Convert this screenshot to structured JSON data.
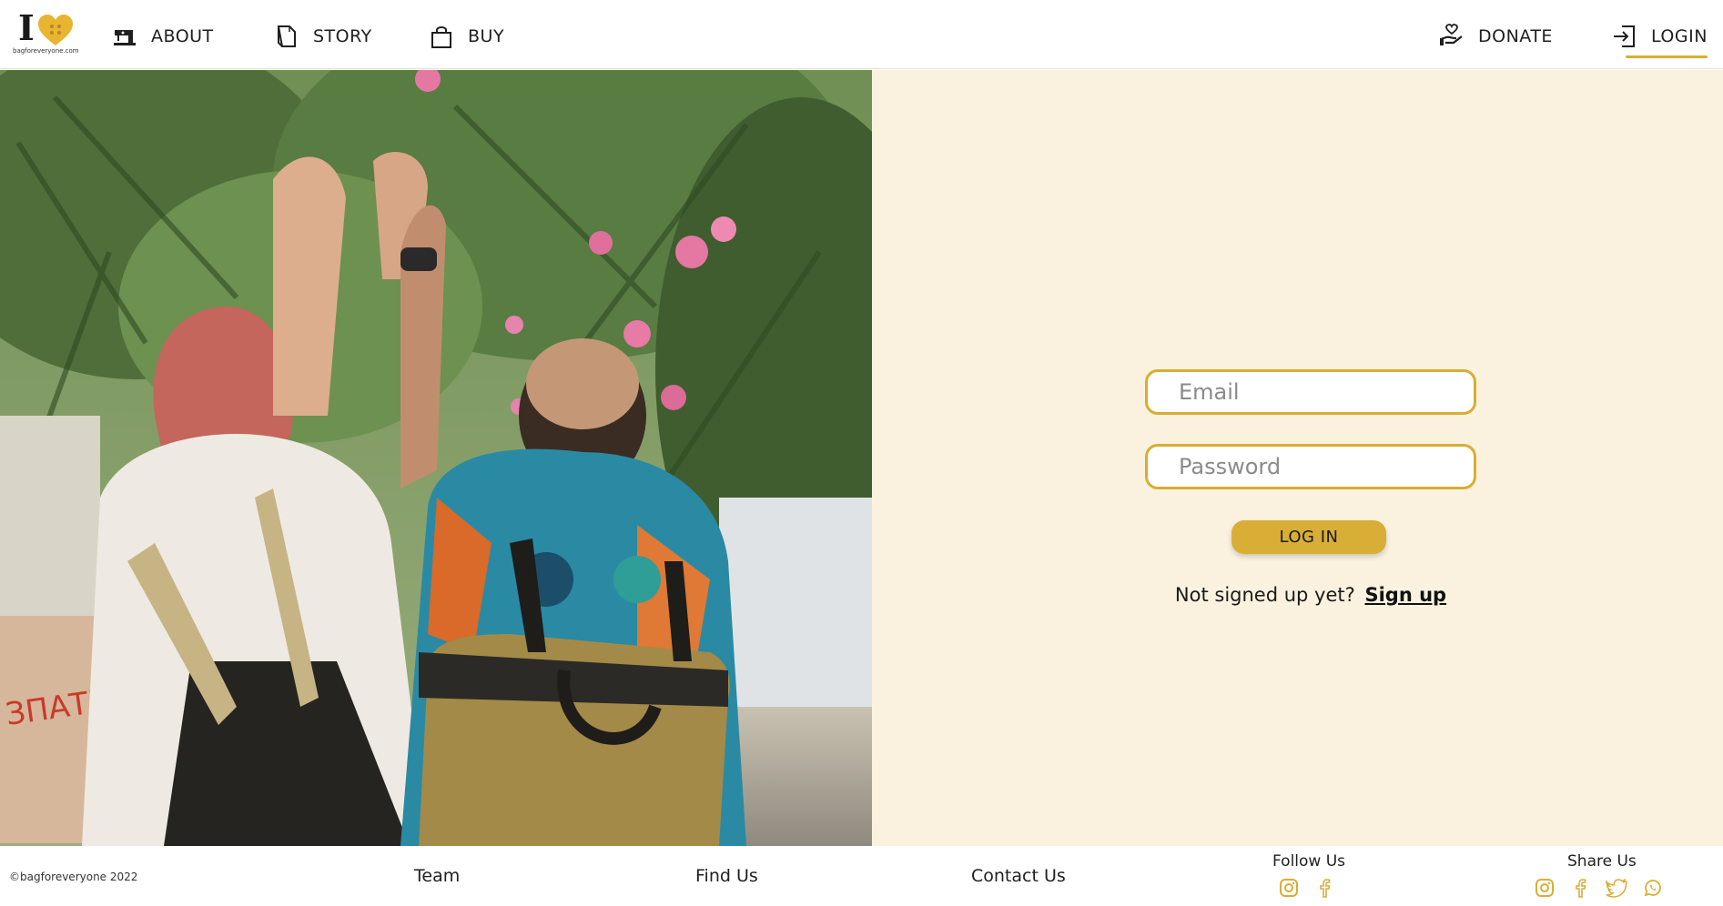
{
  "header": {
    "logo": {
      "letter": "I",
      "site": "bagforeveryone.com"
    },
    "nav": {
      "about": "ABOUT",
      "story": "STORY",
      "buy": "BUY",
      "donate": "DONATE",
      "login": "LOGIN"
    },
    "active_item": "login"
  },
  "login": {
    "email_placeholder": "Email",
    "password_placeholder": "Password",
    "submit_label": "LOG IN",
    "signup_prompt": "Not signed up yet?",
    "signup_link": "Sign up"
  },
  "footer": {
    "copyright": "©bagforeveryone 2022",
    "links": {
      "team": "Team",
      "find_us": "Find Us",
      "contact_us": "Contact Us"
    },
    "follow_heading": "Follow Us",
    "share_heading": "Share Us",
    "follow_icons": [
      "instagram-icon",
      "facebook-icon"
    ],
    "share_icons": [
      "instagram-icon",
      "facebook-icon",
      "twitter-icon",
      "whatsapp-icon"
    ]
  },
  "colors": {
    "accent": "#d8ae37",
    "panel_bg": "#faf2df",
    "text": "#1a1a1a"
  }
}
